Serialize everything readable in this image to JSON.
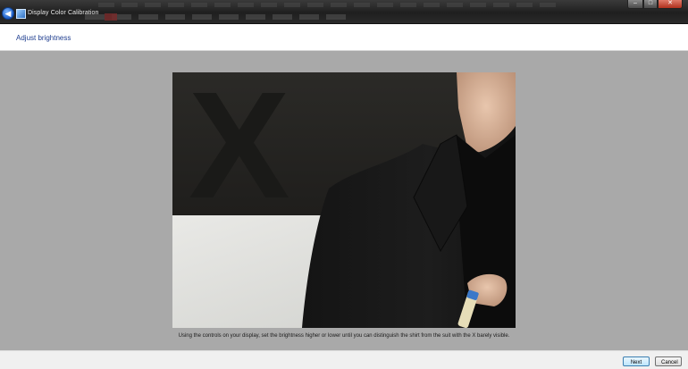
{
  "window": {
    "title": "Display Color Calibration",
    "back_glyph": "◀",
    "controls": {
      "minimize": "–",
      "maximize": "□",
      "close": "✕"
    }
  },
  "page": {
    "title": "Adjust brightness"
  },
  "image": {
    "mark": "X"
  },
  "instruction": "Using the controls on your display, set the brightness higher or lower until you can distinguish the shirt from the suit with the X barely visible.",
  "buttons": {
    "next": "Next",
    "cancel": "Cancel"
  },
  "colors": {
    "accent_title": "#1e3d8f",
    "background": "#a9a9a9"
  }
}
